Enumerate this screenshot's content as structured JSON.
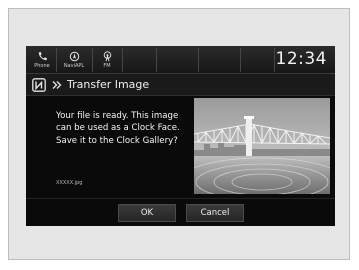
{
  "status_bar": {
    "phone_label": "Phone",
    "navi_label": "NaviAPL",
    "fm_label": "FM",
    "clock": "12:34"
  },
  "header": {
    "nfc_icon": "nfc-icon",
    "chevron_icon": "double-chevron-right-icon",
    "title": "Transfer Image"
  },
  "dialog": {
    "message": "Your file is ready. This image can be used as a Clock Face. Save it to the Clock Gallery?",
    "filename": "XXXXX.jpg"
  },
  "buttons": {
    "ok": "OK",
    "cancel": "Cancel"
  },
  "colors": {
    "screen_bg": "#0a0a0a",
    "text": "#f5f5f5",
    "frame_bg": "#e6e6e6"
  }
}
